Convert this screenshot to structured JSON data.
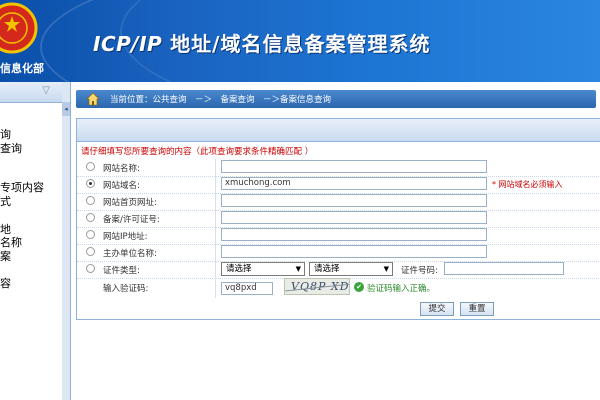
{
  "header": {
    "dept": "信息化部",
    "title_prefix": "ICP/IP",
    "title_rest": " 地址/域名信息备案管理系统"
  },
  "sidebar": {
    "items": [
      "询",
      "查询",
      "专项内容",
      "式",
      "地",
      "名称",
      "案",
      "容"
    ]
  },
  "breadcrumb": {
    "text": "当前位置：公共查询　－＞　备案查询　－＞备案信息查询"
  },
  "form": {
    "notice": "请仔细填写您所要查询的内容（此项查询要求条件精确匹配 ）",
    "fields": [
      {
        "label": "网站名称:",
        "value": "",
        "selected": false
      },
      {
        "label": "网站域名:",
        "value": "xmuchong.com",
        "selected": true
      },
      {
        "label": "网站首页网址:",
        "value": "",
        "selected": false
      },
      {
        "label": "备案/许可证号:",
        "value": "",
        "selected": false
      },
      {
        "label": "网站IP地址:",
        "value": "",
        "selected": false
      },
      {
        "label": "主办单位名称:",
        "value": "",
        "selected": false
      }
    ],
    "domain_hint": "* 网站域名必须输入",
    "cert": {
      "label": "证件类型:",
      "select1": "请选择",
      "select2": "请选择",
      "number_label": "证件号码:",
      "number_value": ""
    },
    "captcha": {
      "label": "输入验证码:",
      "value": "vq8pxd",
      "image_text": "VQ8P XD",
      "status": "验证码输入正确。"
    },
    "buttons": {
      "submit": "提交",
      "reset": "重置"
    }
  },
  "colors": {
    "header": "#1a63c0",
    "accent_red": "#cc0000",
    "ok_green": "#2e8b2e"
  },
  "icons": [
    "national-emblem-icon",
    "home-icon",
    "chevron-down-icon",
    "check-icon"
  ]
}
